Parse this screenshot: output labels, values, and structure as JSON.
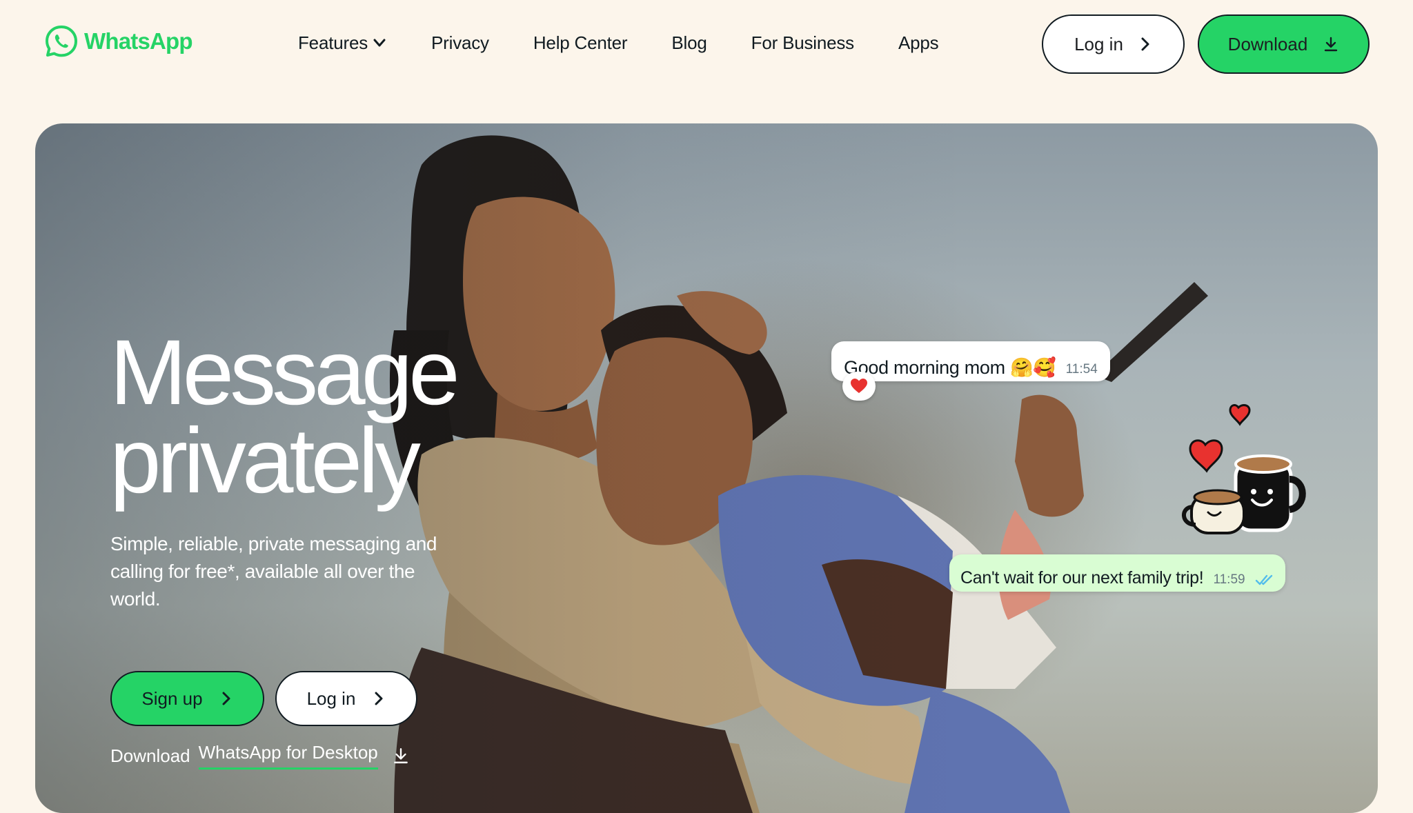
{
  "brand": {
    "name": "WhatsApp",
    "color": "#25d366"
  },
  "nav": {
    "links": [
      {
        "label": "Features",
        "has_dropdown": true
      },
      {
        "label": "Privacy"
      },
      {
        "label": "Help Center"
      },
      {
        "label": "Blog"
      },
      {
        "label": "For Business"
      },
      {
        "label": "Apps"
      }
    ],
    "login_label": "Log in",
    "download_label": "Download"
  },
  "hero": {
    "title_line1": "Message",
    "title_line2": "privately",
    "subtitle": "Simple, reliable, private messaging and calling for free*, available all over the world.",
    "signup_label": "Sign up",
    "login_label": "Log in",
    "download_prefix": "Download",
    "download_link": "WhatsApp for Desktop"
  },
  "chat": {
    "message1": {
      "text": "Good morning mom",
      "emoji": "🤗🥰",
      "time": "11:54",
      "reaction": "❤️"
    },
    "message2": {
      "text": "Can't wait for our next family trip!",
      "time": "11:59",
      "status": "read"
    }
  },
  "colors": {
    "background": "#fcf5eb",
    "accent": "#25d366",
    "dark": "#111b21"
  }
}
